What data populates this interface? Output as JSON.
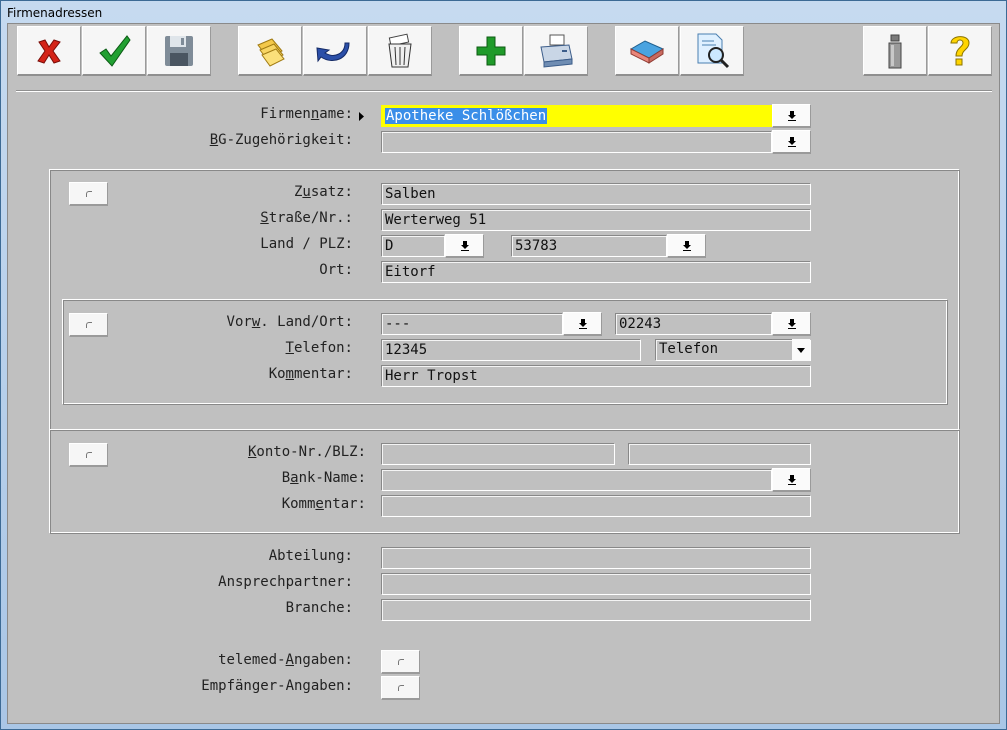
{
  "window": {
    "title": "Firmenadressen"
  },
  "toolbar": {
    "buttons": [
      {
        "id": "cancel",
        "icon": "red-x-icon"
      },
      {
        "id": "ok",
        "icon": "green-check-icon"
      },
      {
        "id": "save",
        "icon": "floppy-disk-icon"
      },
      {
        "id": "folders",
        "icon": "folders-icon"
      },
      {
        "id": "undo",
        "icon": "undo-arrow-icon"
      },
      {
        "id": "delete",
        "icon": "trash-can-icon"
      },
      {
        "id": "add",
        "icon": "green-plus-icon"
      },
      {
        "id": "print",
        "icon": "printer-icon"
      },
      {
        "id": "erase",
        "icon": "eraser-icon"
      },
      {
        "id": "search",
        "icon": "magnifier-document-icon"
      },
      {
        "id": "info",
        "icon": "info-icon"
      },
      {
        "id": "help",
        "icon": "question-mark-icon"
      }
    ]
  },
  "form": {
    "firmenname": {
      "label_pre": "Firmen",
      "label_acc": "n",
      "label_post": "ame:",
      "value": "Apotheke Schlößchen"
    },
    "bg": {
      "label_pre": "",
      "label_acc": "B",
      "label_post": "G-Zugehörigkeit:",
      "value": ""
    },
    "address_group": {
      "zusatz": {
        "label_pre": "Z",
        "label_acc": "u",
        "label_post": "satz:",
        "value": "Salben"
      },
      "strasse": {
        "label_pre": "",
        "label_acc": "S",
        "label_post": "traße/Nr.:",
        "value": "Werterweg 51"
      },
      "land_plz": {
        "label": "Land / PLZ:",
        "land": "D",
        "plz": "53783"
      },
      "ort": {
        "label": "Ort:",
        "value": "Eitorf"
      }
    },
    "phone_group": {
      "vorwahl": {
        "label_pre": "Vor",
        "label_acc": "w",
        "label_post": ". Land/Ort:",
        "land": "---",
        "ort": "02243"
      },
      "telefon": {
        "label_pre": "",
        "label_acc": "T",
        "label_post": "elefon:",
        "value": "12345",
        "type": "Telefon"
      },
      "kommentar": {
        "label_pre": "Ko",
        "label_acc": "m",
        "label_post": "mentar:",
        "value": "Herr Tropst"
      }
    },
    "bank_group": {
      "konto": {
        "label_pre": "",
        "label_acc": "K",
        "label_post": "onto-Nr./BLZ:",
        "konto": "",
        "blz": ""
      },
      "bankname": {
        "label_pre": "B",
        "label_acc": "a",
        "label_post": "nk-Name:",
        "value": ""
      },
      "kommentar": {
        "label_pre": "Komm",
        "label_acc": "e",
        "label_post": "ntar:",
        "value": ""
      }
    },
    "abteilung": {
      "label": "Abteilung:",
      "value": ""
    },
    "ansprechpartner": {
      "label": "Ansprechpartner:",
      "value": ""
    },
    "branche": {
      "label": "Branche:",
      "value": ""
    },
    "telemed": {
      "label_pre": "telemed-",
      "label_acc": "A",
      "label_post": "ngaben:"
    },
    "empfaenger": {
      "label": "Empfänger-Angaben:"
    }
  },
  "colors": {
    "highlight": "#ffff00",
    "selection": "#3a8ee8",
    "dialog_bg": "#c0c0c0"
  }
}
